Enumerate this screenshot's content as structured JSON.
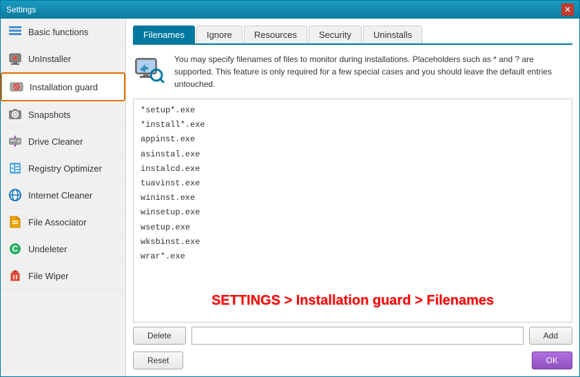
{
  "window": {
    "title": "Settings",
    "close_label": "✕"
  },
  "sidebar": {
    "items": [
      {
        "id": "basic-functions",
        "label": "Basic functions",
        "active": false
      },
      {
        "id": "uninstaller",
        "label": "UnInstaller",
        "active": false
      },
      {
        "id": "installation-guard",
        "label": "Installation guard",
        "active": true
      },
      {
        "id": "snapshots",
        "label": "Snapshots",
        "active": false
      },
      {
        "id": "drive-cleaner",
        "label": "Drive Cleaner",
        "active": false
      },
      {
        "id": "registry-optimizer",
        "label": "Registry Optimizer",
        "active": false
      },
      {
        "id": "internet-cleaner",
        "label": "Internet Cleaner",
        "active": false
      },
      {
        "id": "file-associator",
        "label": "File Associator",
        "active": false
      },
      {
        "id": "undeleter",
        "label": "Undeleter",
        "active": false
      },
      {
        "id": "file-wiper",
        "label": "File Wiper",
        "active": false
      }
    ]
  },
  "tabs": [
    {
      "id": "filenames",
      "label": "Filenames",
      "active": true
    },
    {
      "id": "ignore",
      "label": "Ignore",
      "active": false
    },
    {
      "id": "resources",
      "label": "Resources",
      "active": false
    },
    {
      "id": "security",
      "label": "Security",
      "active": false
    },
    {
      "id": "uninstalls",
      "label": "Uninstalls",
      "active": false
    }
  ],
  "info": {
    "text": "You may specify filenames of files to monitor during installations. Placeholders such as * and ? are supported. This feature is only required for a few special cases and you should leave the default entries untouched."
  },
  "filelist": {
    "entries": [
      "*setup*.exe",
      "*install*.exe",
      "appinst.exe",
      "asinstal.exe",
      "instalcd.exe",
      "tuavinst.exe",
      "wininst.exe",
      "winsetup.exe",
      "wsetup.exe",
      "wksbinst.exe",
      "wrar*.exe"
    ]
  },
  "watermark": {
    "text": "SETTINGS > Installation guard > Filenames"
  },
  "buttons": {
    "delete_label": "Delete",
    "add_label": "Add",
    "reset_label": "Reset",
    "ok_label": "OK"
  }
}
